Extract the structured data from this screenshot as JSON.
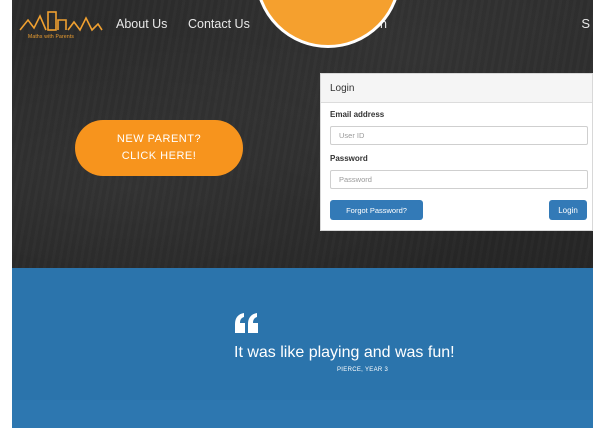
{
  "navbar": {
    "logo_tagline": "Maths with Parents",
    "links": [
      "About Us",
      "Contact Us"
    ],
    "partial_link": "n",
    "right_glyph": "S"
  },
  "hero": {
    "cta_line1": "NEW PARENT?",
    "cta_line2": "CLICK HERE!"
  },
  "login": {
    "title": "Login",
    "email_label": "Email address",
    "email_placeholder": "User ID",
    "password_label": "Password",
    "password_placeholder": "Password",
    "forgot_label": "Forgot Password?",
    "login_label": "Login"
  },
  "testimonial": {
    "quote": "It was like playing and was fun!",
    "author": "PIERCE, YEAR 3"
  },
  "colors": {
    "brand_orange": "#f7941d",
    "testimonial_blue": "#2b74ac",
    "button_blue": "#337ab7",
    "hero_dark": "#2a2a2a"
  }
}
